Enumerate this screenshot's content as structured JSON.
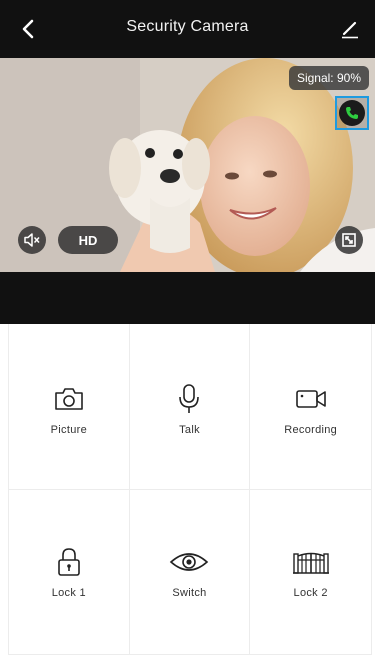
{
  "header": {
    "title": "Security Camera",
    "back_icon": "chevron-left-icon",
    "edit_icon": "pencil-icon"
  },
  "video": {
    "signal_text": "Signal: 90%",
    "quality_label": "HD",
    "call_icon": "phone-icon",
    "mute_icon": "speaker-mute-icon",
    "fullscreen_icon": "fullscreen-icon",
    "accent_color": "#1e9be0"
  },
  "actions": [
    {
      "label": "Picture",
      "icon": "camera-icon"
    },
    {
      "label": "Talk",
      "icon": "microphone-icon"
    },
    {
      "label": "Recording",
      "icon": "video-camera-icon"
    },
    {
      "label": "Lock 1",
      "icon": "padlock-icon"
    },
    {
      "label": "Switch",
      "icon": "eye-icon"
    },
    {
      "label": "Lock 2",
      "icon": "gate-icon"
    }
  ]
}
